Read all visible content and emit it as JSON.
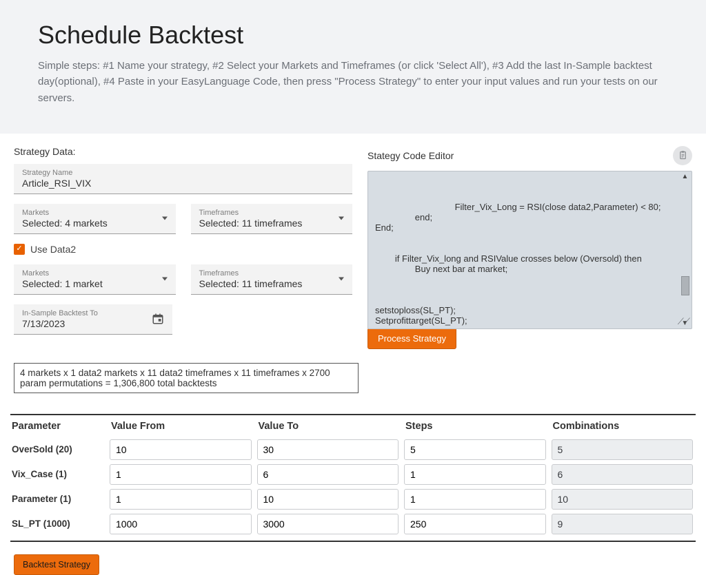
{
  "header": {
    "title": "Schedule Backtest",
    "subtitle": "Simple steps: #1 Name your strategy, #2 Select your Markets and Timeframes (or click 'Select All'), #3 Add the last In-Sample backtest day(optional), #4 Paste in your EasyLanguage Code, then press \"Process Strategy\" to enter your input values and run your tests on our servers."
  },
  "left": {
    "section_label": "Strategy Data:",
    "strategy_name_label": "Strategy Name",
    "strategy_name_value": "Article_RSI_VIX",
    "markets1_label": "Markets",
    "markets1_value": "Selected: 4 markets",
    "timeframes1_label": "Timeframes",
    "timeframes1_value": "Selected: 11 timeframes",
    "use_data2": "Use Data2",
    "markets2_label": "Markets",
    "markets2_value": "Selected: 1 market",
    "timeframes2_label": "Timeframes",
    "timeframes2_value": "Selected: 11 timeframes",
    "insample_label": "In-Sample Backtest To",
    "insample_value": "7/13/2023",
    "summary": "4 markets x 1 data2 markets x 11 data2 timeframes x 11 timeframes x 2700 param permutations = 1,306,800 total backtests"
  },
  "right": {
    "section_label": "Stategy Code Editor",
    "code_lines": [
      "                                Filter_Vix_Long = RSI(close data2,Parameter) < 80;",
      "                end;",
      "End;",
      " ",
      " ",
      "        if Filter_Vix_long and RSIValue crosses below (Oversold) then",
      "                Buy next bar at market;",
      " ",
      " ",
      " ",
      "setstoploss(SL_PT);",
      "Setprofittarget(SL_PT);"
    ],
    "process_btn": "Process Strategy"
  },
  "table": {
    "headers": {
      "param": "Parameter",
      "from": "Value From",
      "to": "Value To",
      "steps": "Steps",
      "comb": "Combinations"
    },
    "rows": [
      {
        "name": "OverSold (20)",
        "from": "10",
        "to": "30",
        "steps": "5",
        "comb": "5"
      },
      {
        "name": "Vix_Case (1)",
        "from": "1",
        "to": "6",
        "steps": "1",
        "comb": "6"
      },
      {
        "name": "Parameter (1)",
        "from": "1",
        "to": "10",
        "steps": "1",
        "comb": "10"
      },
      {
        "name": "SL_PT (1000)",
        "from": "1000",
        "to": "3000",
        "steps": "250",
        "comb": "9"
      }
    ]
  },
  "footer": {
    "backtest_btn": "Backtest Strategy"
  }
}
